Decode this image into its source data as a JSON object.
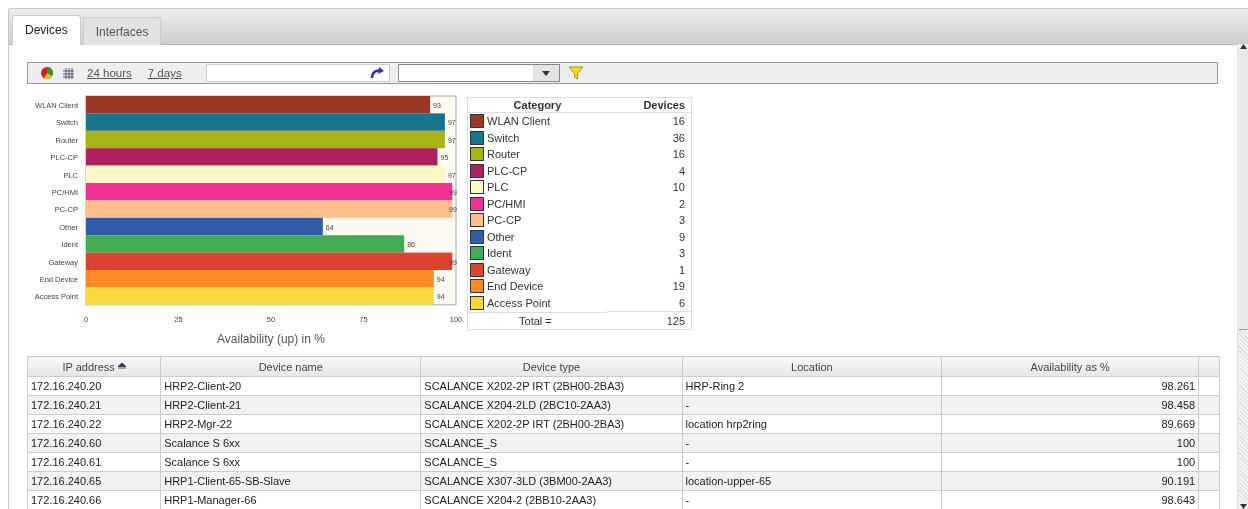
{
  "tabs": [
    {
      "label": "Devices",
      "selected": true
    },
    {
      "label": "Interfaces",
      "selected": false
    }
  ],
  "toolbar": {
    "links": [
      "24 hours",
      "7 days"
    ]
  },
  "chart": {
    "chart_data": {
      "type": "bar",
      "orientation": "horizontal",
      "xlabel": "Availability (up) in %",
      "categories": [
        "WLAN Client",
        "Switch",
        "Router",
        "PLC-CP",
        "PLC",
        "PC/HMI",
        "PC-CP",
        "Other",
        "Ident",
        "Gateway",
        "End Device",
        "Access Point"
      ],
      "values": [
        93,
        97,
        97,
        95,
        97,
        99,
        99,
        64,
        86,
        99,
        94,
        94
      ],
      "xlim": [
        0,
        100
      ],
      "xticks": [
        0,
        25,
        50,
        75,
        100
      ],
      "data_labels": true
    }
  },
  "legend": {
    "columns": [
      "Category",
      "Devices"
    ],
    "rows": [
      {
        "category": "WLAN Client",
        "devices": "16",
        "color": "#9b3a24"
      },
      {
        "category": "Switch",
        "devices": "36",
        "color": "#17758f"
      },
      {
        "category": "Router",
        "devices": "16",
        "color": "#a8b413"
      },
      {
        "category": "PLC-CP",
        "devices": "4",
        "color": "#b0205e"
      },
      {
        "category": "PLC",
        "devices": "10",
        "color": "#fdf7c3"
      },
      {
        "category": "PC/HMI",
        "devices": "2",
        "color": "#f03196"
      },
      {
        "category": "PC-CP",
        "devices": "3",
        "color": "#fdbe8b"
      },
      {
        "category": "Other",
        "devices": "9",
        "color": "#2f5ea8"
      },
      {
        "category": "Ident",
        "devices": "3",
        "color": "#42ab53"
      },
      {
        "category": "Gateway",
        "devices": "1",
        "color": "#dd4430"
      },
      {
        "category": "End Device",
        "devices": "19",
        "color": "#fb8a26"
      },
      {
        "category": "Access Point",
        "devices": "6",
        "color": "#fbd63c"
      }
    ],
    "total_label": "Total =",
    "total": "125"
  },
  "table": {
    "columns": [
      "IP address",
      "Device name",
      "Device type",
      "Location",
      "Availability as %"
    ],
    "rows": [
      [
        "172.16.240.20",
        "HRP2-Client-20",
        "SCALANCE X202-2P IRT (2BH00-2BA3)",
        "HRP-Ring 2",
        "98.261"
      ],
      [
        "172.16.240.21",
        "HRP2-Client-21",
        "SCALANCE X204-2LD (2BC10-2AA3)",
        "-",
        "98.458"
      ],
      [
        "172.16.240.22",
        "HRP2-Mgr-22",
        "SCALANCE X202-2P IRT (2BH00-2BA3)",
        "location hrp2ring",
        "89.669"
      ],
      [
        "172.16.240.60",
        "Scalance S 6xx",
        "SCALANCE_S",
        "-",
        "100"
      ],
      [
        "172.16.240.61",
        "Scalance S 6xx",
        "SCALANCE_S",
        "-",
        "100"
      ],
      [
        "172.16.240.65",
        "HRP1-Client-65-SB-Slave",
        "SCALANCE X307-3LD (3BM00-2AA3)",
        "location-upper-65",
        "90.191"
      ],
      [
        "172.16.240.66",
        "HRP1-Manager-66",
        "SCALANCE X204-2 (2BB10-2AA3)",
        "-",
        "98.643"
      ]
    ]
  }
}
